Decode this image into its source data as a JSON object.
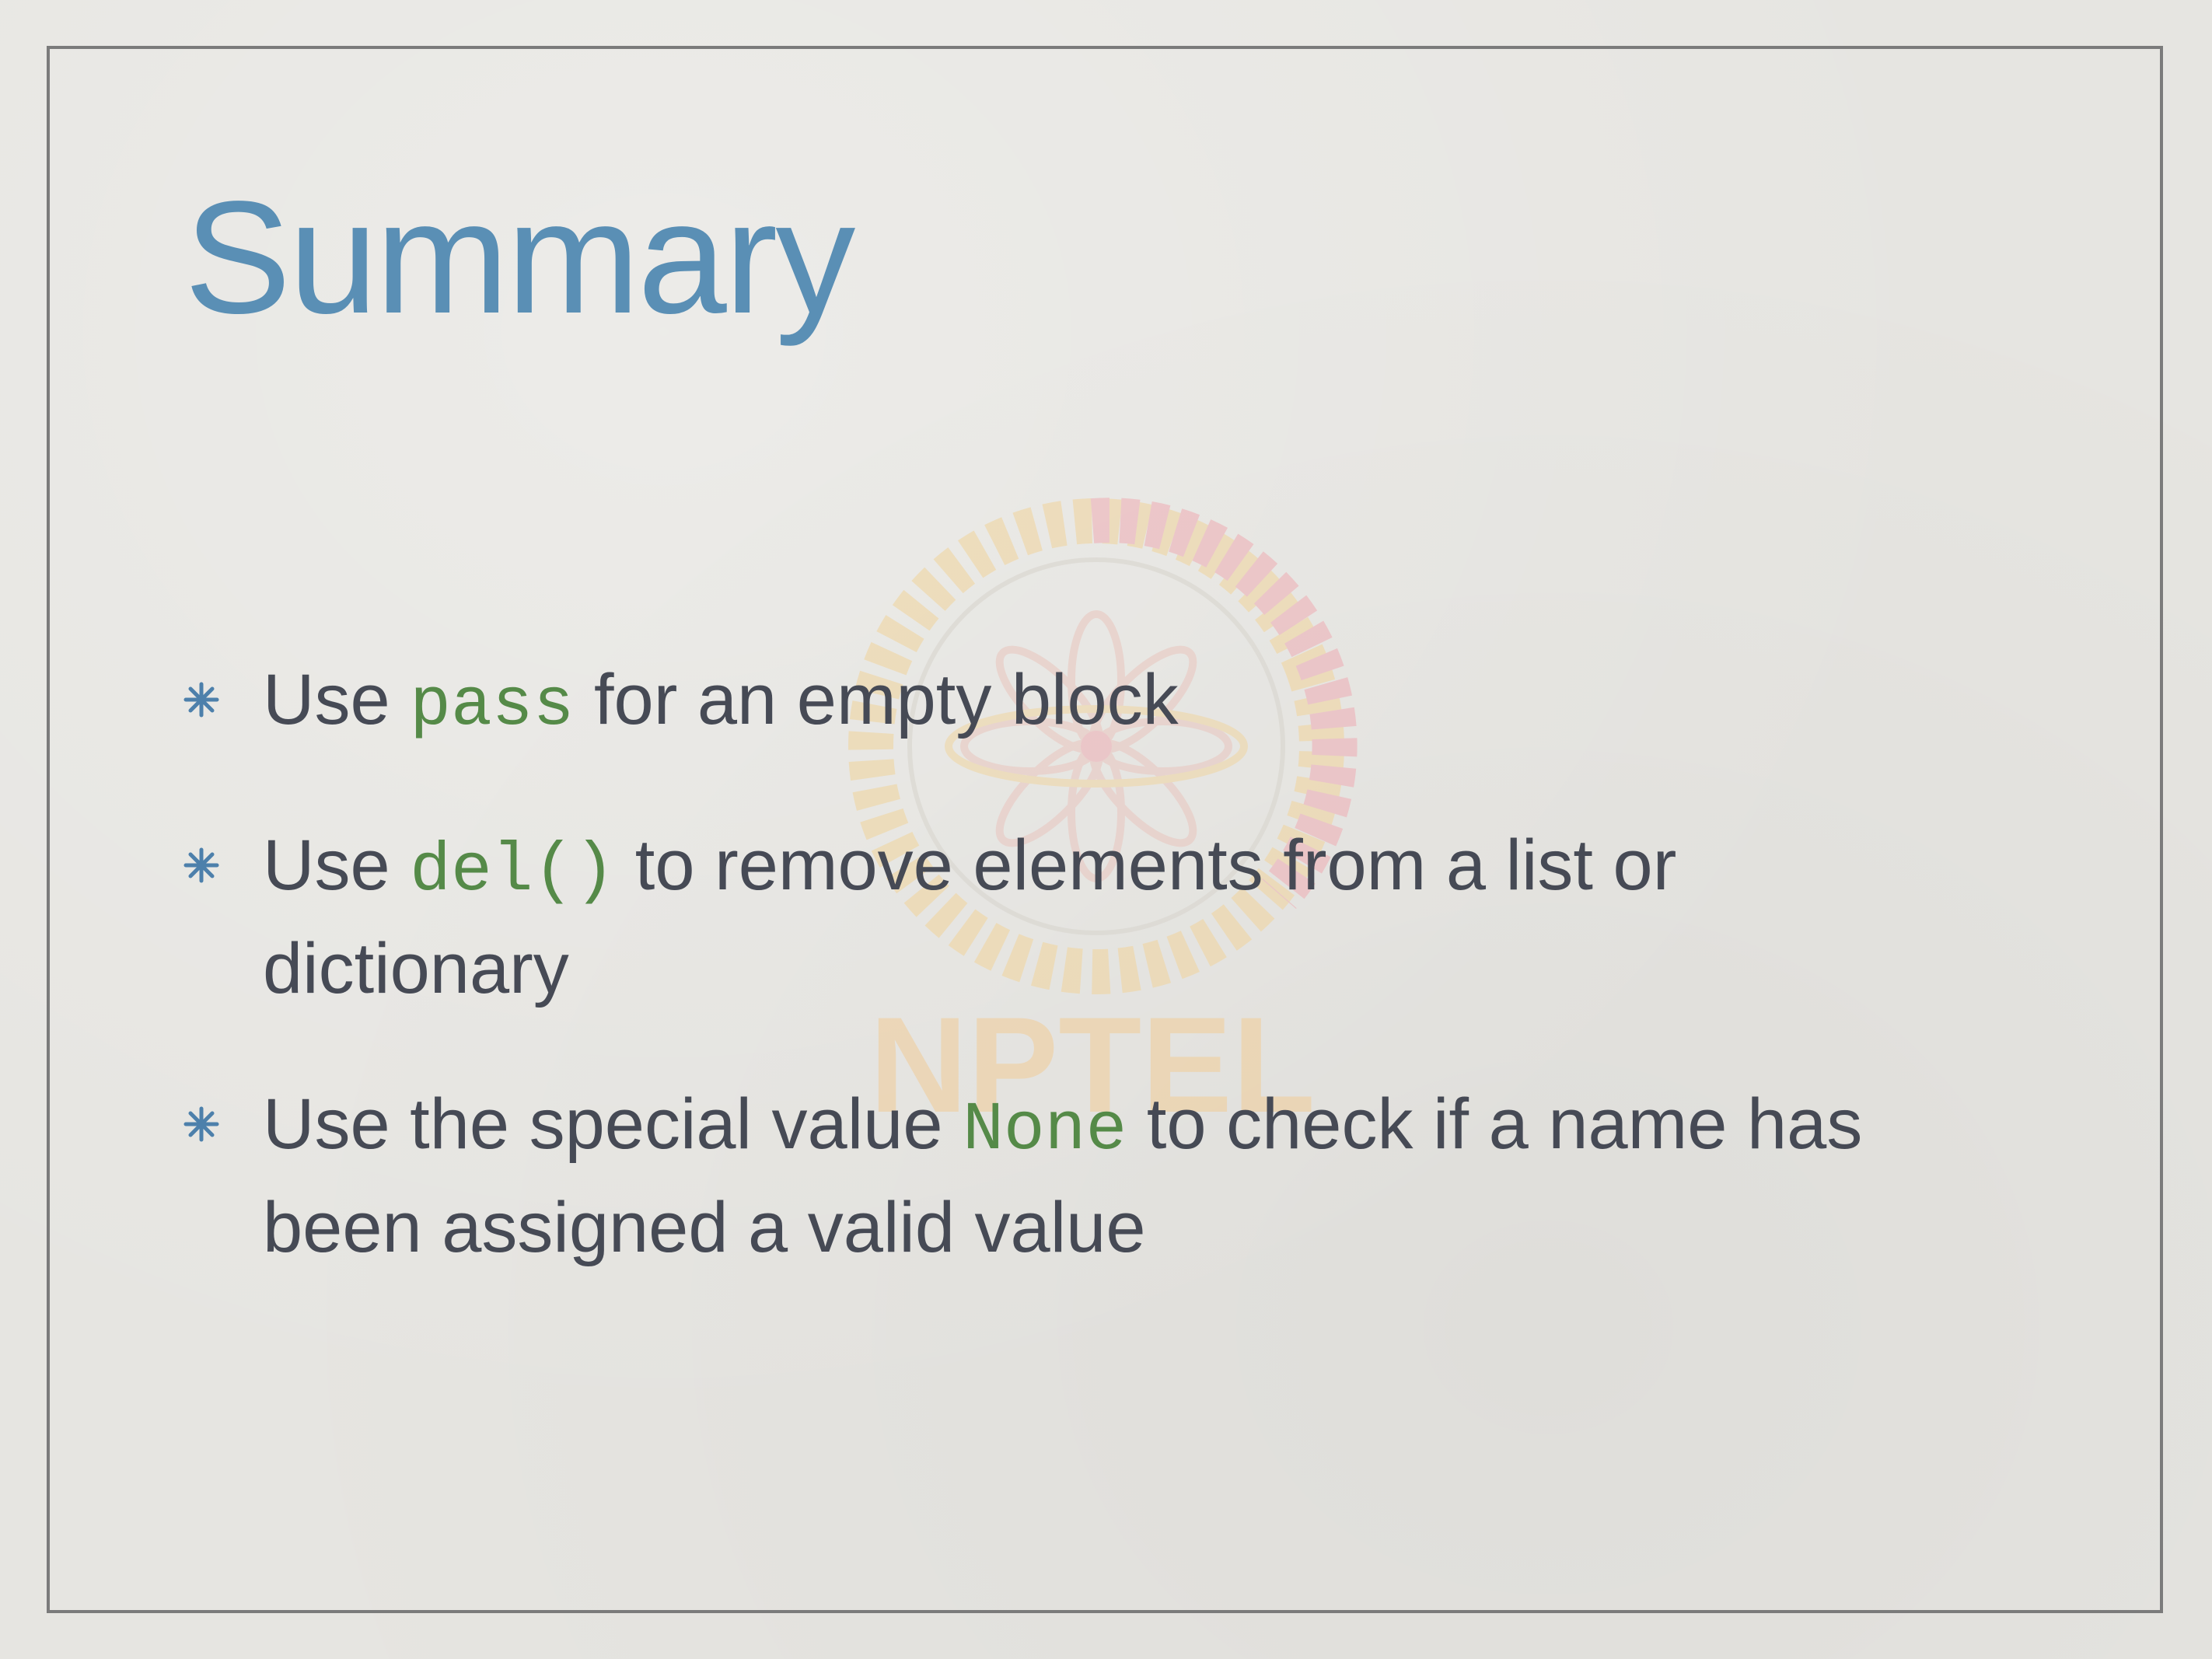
{
  "slide": {
    "title": "Summary",
    "watermark_text": "NPTEL",
    "bullets": [
      {
        "line1_before": "Use ",
        "line1_code": "pass",
        "line1_after": " for an empty block"
      },
      {
        "line1_before": "Use ",
        "line1_code": "del()",
        "line1_after": " to remove elements from a list or",
        "line2": "dictionary"
      },
      {
        "line1_before": "Use the special value ",
        "line1_code": "None",
        "line1_after": " to check if a name has",
        "line2": "been assigned a valid value"
      }
    ]
  },
  "colors": {
    "title": "#5a8fb5",
    "body_text": "#464a55",
    "code": "#558a48",
    "bullet": "#4d80ab",
    "frame": "#7b7b7b",
    "background": "#e6e5e1"
  },
  "icons": {
    "bullet": "asterisk-bullet-icon",
    "watermark": "nptel-logo-watermark"
  }
}
